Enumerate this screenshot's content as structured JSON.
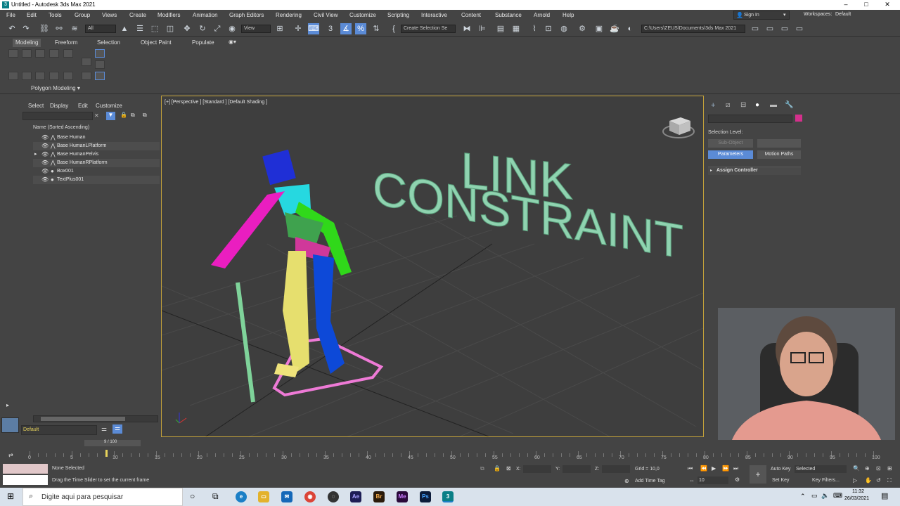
{
  "window": {
    "title": "Untitled - Autodesk 3ds Max 2021",
    "app_icon": "3ds-max-icon"
  },
  "menubar": {
    "items": [
      "File",
      "Edit",
      "Tools",
      "Group",
      "Views",
      "Create",
      "Modifiers",
      "Animation",
      "Graph Editors",
      "Rendering",
      "Civil View",
      "Customize",
      "Scripting",
      "Interactive",
      "Content",
      "Substance",
      "Arnold",
      "Help"
    ],
    "sign_in": "Sign In",
    "workspaces_label": "Workspaces:",
    "workspaces_value": "Default"
  },
  "toolbar": {
    "filter": "All",
    "ref_coord": "View",
    "selection_set": "Create Selection Se",
    "project_path": "C:\\Users\\ZEUS\\Documents\\3ds Max 2021"
  },
  "ribbon": {
    "tabs": [
      "Modeling",
      "Freeform",
      "Selection",
      "Object Paint",
      "Populate"
    ],
    "active_tab": "Modeling",
    "panel_label": "Polygon Modeling"
  },
  "explorer": {
    "menu": [
      "Select",
      "Display",
      "Edit",
      "Customize"
    ],
    "column_header": "Name (Sorted Ascending)",
    "items": [
      "Base Human",
      "Base HumanLPlatform",
      "Base HumanPelvis",
      "Base HumanRPlatform",
      "Box001",
      "TextPlus001"
    ],
    "layer": "Default"
  },
  "viewport": {
    "label": "[+] [Perspective ] [Standard ] [Default Shading ]",
    "text_line1": "LINK",
    "text_line2": "CONSTRAINT"
  },
  "command_panel": {
    "selection_level": "Selection Level:",
    "sub_object": "Sub-Object",
    "parameters": "Parameters",
    "motion_paths": "Motion Paths",
    "assign_controller": "Assign Controller"
  },
  "timeline": {
    "frame_display": "9 / 100",
    "current_frame": 9,
    "ticks": [
      "0",
      "5",
      "10",
      "15",
      "20",
      "25",
      "30",
      "35",
      "40",
      "45",
      "50",
      "55",
      "60",
      "65",
      "70",
      "75",
      "80",
      "85",
      "90",
      "95",
      "100"
    ]
  },
  "status": {
    "selection": "None Selected",
    "prompt": "Drag the Time Slider to set the current frame",
    "x_label": "X:",
    "y_label": "Y:",
    "z_label": "Z:",
    "grid": "Grid = 10,0",
    "add_time_tag": "Add Time Tag",
    "auto_key": "Auto Key",
    "set_key": "Set Key",
    "key_mode": "Selected",
    "key_filters": "Key Filters...",
    "frame_field": "10"
  },
  "taskbar": {
    "search_placeholder": "Digite aqui para pesquisar",
    "time": "11:32",
    "date": "26/03/2021"
  },
  "colors": {
    "accent": "#5b8bd6",
    "viewport_border": "#c4a23a",
    "text3d": "#8fd3b0"
  }
}
